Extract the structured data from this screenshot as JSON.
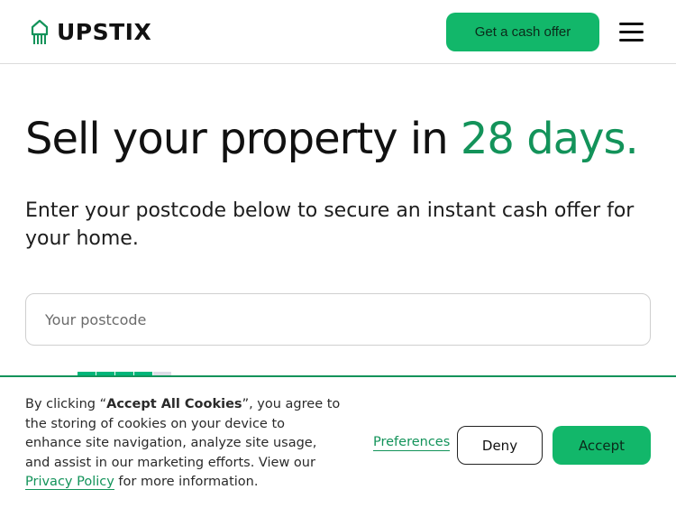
{
  "header": {
    "logo_text": "UPSTIX",
    "cta_label": "Get a cash offer",
    "menu_icon": "hamburger-menu-icon"
  },
  "hero": {
    "title_main": "Sell your property in ",
    "title_accent": "28 days.",
    "subtitle": "Enter your postcode below to secure an instant cash offer for your home.",
    "postcode_placeholder": "Your postcode"
  },
  "trust": {
    "stars_filled": 4,
    "stars_total": 5
  },
  "cookie_banner": {
    "text_before": "By clicking “",
    "text_bold": "Accept All Cookies",
    "text_middle": "”, you agree to the storing of cookies on your device to enhance site navigation, analyze site usage, and assist in our marketing efforts. View our ",
    "privacy_link": "Privacy Policy",
    "text_after": " for more information.",
    "preferences_label": "Preferences",
    "deny_label": "Deny",
    "accept_label": "Accept"
  },
  "colors": {
    "brand_green": "#12b76a",
    "accent_text_green": "#13935a",
    "trust_green": "#00b67a"
  }
}
